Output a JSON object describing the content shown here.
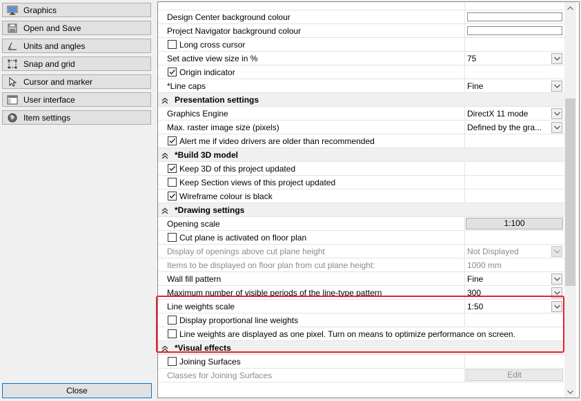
{
  "nav": {
    "items": [
      {
        "label": "Graphics",
        "icon": "monitor-icon"
      },
      {
        "label": "Open and Save",
        "icon": "disk-icon"
      },
      {
        "label": "Units and angles",
        "icon": "angle-icon"
      },
      {
        "label": "Snap and grid",
        "icon": "snap-grid-icon"
      },
      {
        "label": "Cursor and marker",
        "icon": "cursor-icon"
      },
      {
        "label": "User interface",
        "icon": "window-icon"
      },
      {
        "label": "Item settings",
        "icon": "globe-icon"
      }
    ],
    "close_label": "Close"
  },
  "properties": {
    "rows": [
      {
        "type": "blank",
        "name": "",
        "value": ""
      },
      {
        "type": "color",
        "name": "Design Center background colour"
      },
      {
        "type": "color",
        "name": "Project Navigator background colour"
      },
      {
        "type": "check",
        "name": "Long cross cursor",
        "checked": false
      },
      {
        "type": "dropdown",
        "name": "Set active view size in %",
        "value": "75"
      },
      {
        "type": "check",
        "name": "Origin indicator",
        "checked": true
      },
      {
        "type": "dropdown",
        "name": "*Line caps",
        "value": "Fine"
      },
      {
        "type": "section",
        "name": "Presentation settings"
      },
      {
        "type": "dropdown",
        "name": "Graphics Engine",
        "value": "DirectX 11 mode"
      },
      {
        "type": "dropdown",
        "name": "Max. raster image size (pixels)",
        "value": "Defined by the gra..."
      },
      {
        "type": "check",
        "name": "Alert me if video drivers are older than recommended",
        "checked": true
      },
      {
        "type": "section",
        "name": "*Build 3D model"
      },
      {
        "type": "check",
        "name": "Keep 3D of this project updated",
        "checked": true
      },
      {
        "type": "check",
        "name": "Keep Section views of this project updated",
        "checked": false
      },
      {
        "type": "check",
        "name": "Wireframe colour is black",
        "checked": true
      },
      {
        "type": "section",
        "name": "*Drawing settings"
      },
      {
        "type": "button",
        "name": "Opening scale",
        "value": "1:100"
      },
      {
        "type": "check",
        "name": "Cut plane is activated on floor plan",
        "checked": false
      },
      {
        "type": "dropdown",
        "name": "Display of openings above cut plane height",
        "value": "Not Displayed",
        "disabled": true
      },
      {
        "type": "text",
        "name": "Items to be displayed on floor plan from cut plane height:",
        "value": "1000 mm",
        "disabled": true
      },
      {
        "type": "dropdown",
        "name": "Wall fill pattern",
        "value": "Fine"
      },
      {
        "type": "dropdown",
        "name": "Maximum number of visible periods of the line-type pattern",
        "value": "300"
      },
      {
        "type": "dropdown",
        "name": "Line weights scale",
        "value": "1:50"
      },
      {
        "type": "check",
        "name": "Display proportional line weights",
        "checked": false
      },
      {
        "type": "check",
        "name": "Line weights are displayed as one pixel. Turn on means to optimize performance on screen.",
        "checked": false
      },
      {
        "type": "section",
        "name": "*Visual effects"
      },
      {
        "type": "check",
        "name": "Joining Surfaces",
        "checked": false
      },
      {
        "type": "button",
        "name": "Classes for Joining Surfaces",
        "value": "Edit",
        "disabled": true
      }
    ]
  },
  "colors": {
    "highlight": "#e8212b",
    "focus_border": "#0078d7"
  }
}
